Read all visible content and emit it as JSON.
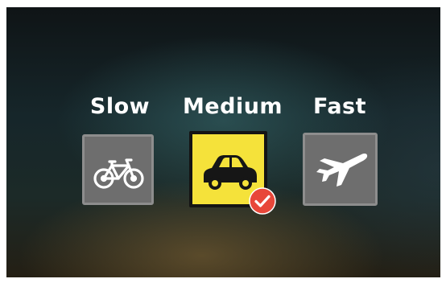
{
  "speed_selector": {
    "options": [
      {
        "label": "Slow",
        "icon": "bicycle-icon",
        "selected": false
      },
      {
        "label": "Medium",
        "icon": "car-icon",
        "selected": true
      },
      {
        "label": "Fast",
        "icon": "airplane-icon",
        "selected": false
      }
    ],
    "selected_badge_icon": "checkmark-icon"
  },
  "colors": {
    "selected_background": "#f5e23a",
    "unselected_background": "#6e6e6e",
    "check_badge": "#e8473a"
  }
}
